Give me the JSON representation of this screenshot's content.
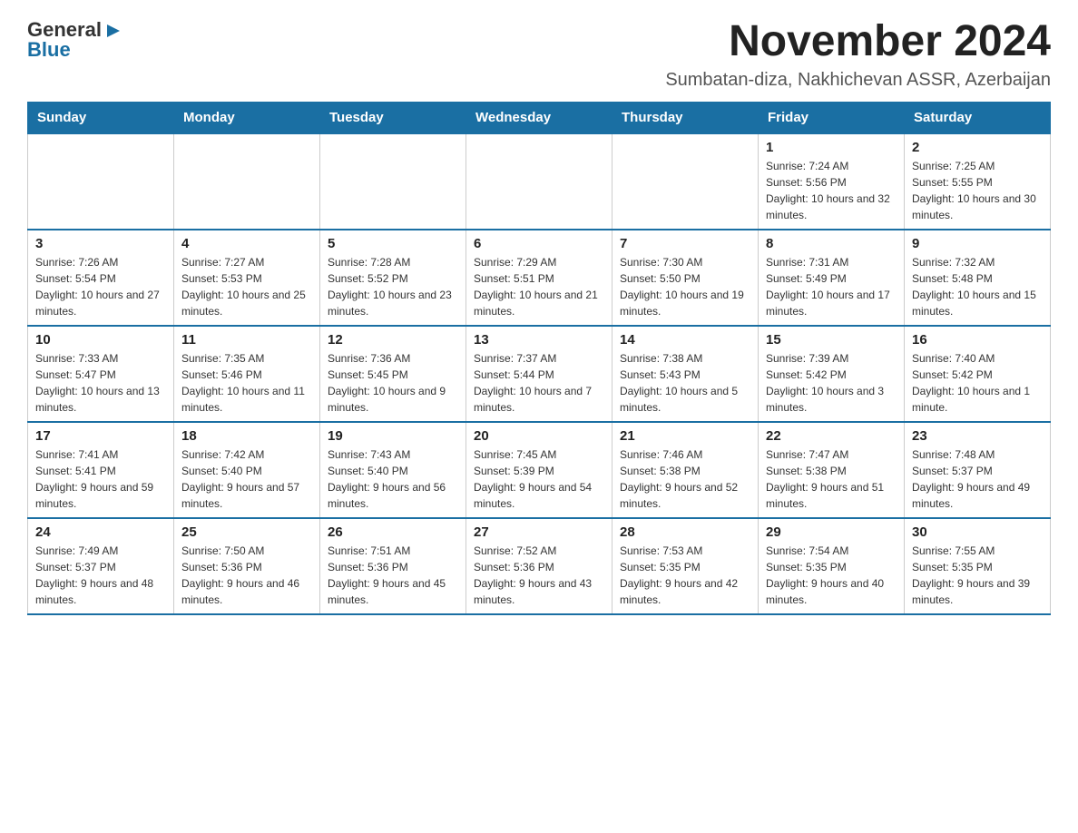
{
  "header": {
    "logo": {
      "general": "General",
      "blue": "Blue",
      "arrow": "▶"
    },
    "month_year": "November 2024",
    "location": "Sumbatan-diza, Nakhichevan ASSR, Azerbaijan"
  },
  "calendar": {
    "days_of_week": [
      "Sunday",
      "Monday",
      "Tuesday",
      "Wednesday",
      "Thursday",
      "Friday",
      "Saturday"
    ],
    "weeks": [
      [
        {
          "day": "",
          "info": ""
        },
        {
          "day": "",
          "info": ""
        },
        {
          "day": "",
          "info": ""
        },
        {
          "day": "",
          "info": ""
        },
        {
          "day": "",
          "info": ""
        },
        {
          "day": "1",
          "info": "Sunrise: 7:24 AM\nSunset: 5:56 PM\nDaylight: 10 hours and 32 minutes."
        },
        {
          "day": "2",
          "info": "Sunrise: 7:25 AM\nSunset: 5:55 PM\nDaylight: 10 hours and 30 minutes."
        }
      ],
      [
        {
          "day": "3",
          "info": "Sunrise: 7:26 AM\nSunset: 5:54 PM\nDaylight: 10 hours and 27 minutes."
        },
        {
          "day": "4",
          "info": "Sunrise: 7:27 AM\nSunset: 5:53 PM\nDaylight: 10 hours and 25 minutes."
        },
        {
          "day": "5",
          "info": "Sunrise: 7:28 AM\nSunset: 5:52 PM\nDaylight: 10 hours and 23 minutes."
        },
        {
          "day": "6",
          "info": "Sunrise: 7:29 AM\nSunset: 5:51 PM\nDaylight: 10 hours and 21 minutes."
        },
        {
          "day": "7",
          "info": "Sunrise: 7:30 AM\nSunset: 5:50 PM\nDaylight: 10 hours and 19 minutes."
        },
        {
          "day": "8",
          "info": "Sunrise: 7:31 AM\nSunset: 5:49 PM\nDaylight: 10 hours and 17 minutes."
        },
        {
          "day": "9",
          "info": "Sunrise: 7:32 AM\nSunset: 5:48 PM\nDaylight: 10 hours and 15 minutes."
        }
      ],
      [
        {
          "day": "10",
          "info": "Sunrise: 7:33 AM\nSunset: 5:47 PM\nDaylight: 10 hours and 13 minutes."
        },
        {
          "day": "11",
          "info": "Sunrise: 7:35 AM\nSunset: 5:46 PM\nDaylight: 10 hours and 11 minutes."
        },
        {
          "day": "12",
          "info": "Sunrise: 7:36 AM\nSunset: 5:45 PM\nDaylight: 10 hours and 9 minutes."
        },
        {
          "day": "13",
          "info": "Sunrise: 7:37 AM\nSunset: 5:44 PM\nDaylight: 10 hours and 7 minutes."
        },
        {
          "day": "14",
          "info": "Sunrise: 7:38 AM\nSunset: 5:43 PM\nDaylight: 10 hours and 5 minutes."
        },
        {
          "day": "15",
          "info": "Sunrise: 7:39 AM\nSunset: 5:42 PM\nDaylight: 10 hours and 3 minutes."
        },
        {
          "day": "16",
          "info": "Sunrise: 7:40 AM\nSunset: 5:42 PM\nDaylight: 10 hours and 1 minute."
        }
      ],
      [
        {
          "day": "17",
          "info": "Sunrise: 7:41 AM\nSunset: 5:41 PM\nDaylight: 9 hours and 59 minutes."
        },
        {
          "day": "18",
          "info": "Sunrise: 7:42 AM\nSunset: 5:40 PM\nDaylight: 9 hours and 57 minutes."
        },
        {
          "day": "19",
          "info": "Sunrise: 7:43 AM\nSunset: 5:40 PM\nDaylight: 9 hours and 56 minutes."
        },
        {
          "day": "20",
          "info": "Sunrise: 7:45 AM\nSunset: 5:39 PM\nDaylight: 9 hours and 54 minutes."
        },
        {
          "day": "21",
          "info": "Sunrise: 7:46 AM\nSunset: 5:38 PM\nDaylight: 9 hours and 52 minutes."
        },
        {
          "day": "22",
          "info": "Sunrise: 7:47 AM\nSunset: 5:38 PM\nDaylight: 9 hours and 51 minutes."
        },
        {
          "day": "23",
          "info": "Sunrise: 7:48 AM\nSunset: 5:37 PM\nDaylight: 9 hours and 49 minutes."
        }
      ],
      [
        {
          "day": "24",
          "info": "Sunrise: 7:49 AM\nSunset: 5:37 PM\nDaylight: 9 hours and 48 minutes."
        },
        {
          "day": "25",
          "info": "Sunrise: 7:50 AM\nSunset: 5:36 PM\nDaylight: 9 hours and 46 minutes."
        },
        {
          "day": "26",
          "info": "Sunrise: 7:51 AM\nSunset: 5:36 PM\nDaylight: 9 hours and 45 minutes."
        },
        {
          "day": "27",
          "info": "Sunrise: 7:52 AM\nSunset: 5:36 PM\nDaylight: 9 hours and 43 minutes."
        },
        {
          "day": "28",
          "info": "Sunrise: 7:53 AM\nSunset: 5:35 PM\nDaylight: 9 hours and 42 minutes."
        },
        {
          "day": "29",
          "info": "Sunrise: 7:54 AM\nSunset: 5:35 PM\nDaylight: 9 hours and 40 minutes."
        },
        {
          "day": "30",
          "info": "Sunrise: 7:55 AM\nSunset: 5:35 PM\nDaylight: 9 hours and 39 minutes."
        }
      ]
    ]
  }
}
